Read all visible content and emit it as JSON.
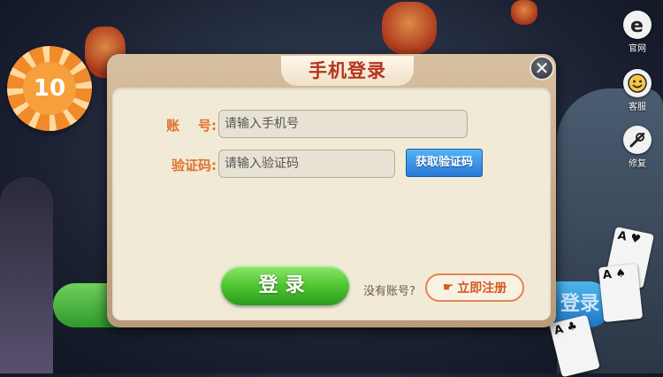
{
  "side_buttons": [
    {
      "label": "官网",
      "icon": "browser-icon"
    },
    {
      "label": "客服",
      "icon": "smiley-icon"
    },
    {
      "label": "修复",
      "icon": "wrench-icon"
    }
  ],
  "background": {
    "chip_text": "10",
    "login_text": "登录"
  },
  "dialog": {
    "title": "手机登录",
    "close_symbol": "✕",
    "account_label": "账    号:",
    "account_placeholder": "请输入手机号",
    "code_label": "验证码:",
    "code_placeholder": "请输入验证码",
    "get_code_button": "获取验证码",
    "login_button": "登录",
    "no_account_text": "没有账号?",
    "register_button": "立即注册"
  },
  "colors": {
    "title": "#b4341e",
    "label": "#e0712a",
    "login_green": "#4fc632",
    "code_blue": "#2a78d8",
    "register_orange": "#d65a1e"
  }
}
